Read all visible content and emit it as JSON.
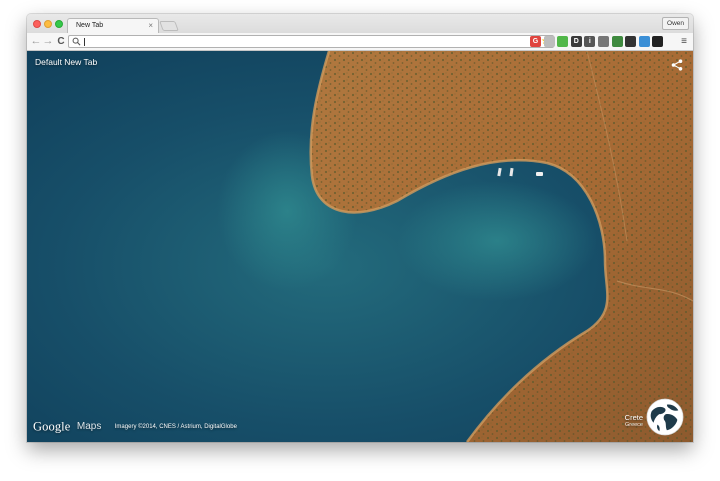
{
  "browser": {
    "tab": {
      "title": "New Tab",
      "close_glyph": "×"
    },
    "profile": {
      "name": "Owen"
    },
    "toolbar": {
      "back_glyph": "←",
      "forward_glyph": "→",
      "reload_glyph": "C",
      "omnibox_value": "",
      "bookmark_icon": "star-icon"
    },
    "extensions": [
      {
        "name": "red-g-extension-icon",
        "glyph": "G",
        "color": "#e0443e"
      },
      {
        "name": "circle-extension-icon",
        "glyph": "",
        "color": "#bdbdbd"
      },
      {
        "name": "evernote-extension-icon",
        "glyph": "",
        "color": "#51b749"
      },
      {
        "name": "d-extension-icon",
        "glyph": "D",
        "color": "#3a3a3a"
      },
      {
        "name": "info-extension-icon",
        "glyph": "i",
        "color": "#555555"
      },
      {
        "name": "window-extension-icon",
        "glyph": "",
        "color": "#777777"
      },
      {
        "name": "plant-extension-icon",
        "glyph": "",
        "color": "#3f8a3f"
      },
      {
        "name": "pocket-extension-icon",
        "glyph": "",
        "color": "#333333"
      },
      {
        "name": "cloud-extension-icon",
        "glyph": "",
        "color": "#3b8fd6"
      },
      {
        "name": "dark-extension-icon",
        "glyph": "",
        "color": "#222222"
      }
    ],
    "menu_glyph": "≡"
  },
  "page": {
    "default_new_tab_link": "Default New Tab",
    "share_icon": "share-icon",
    "footer": {
      "google_logo": "Google",
      "maps_label": "Maps",
      "attribution": "Imagery ©2014, CNES / Astrium, DigitalGlobe"
    },
    "location": {
      "name": "Crete",
      "country": "Greece"
    },
    "globe_icon": "globe-icon"
  }
}
